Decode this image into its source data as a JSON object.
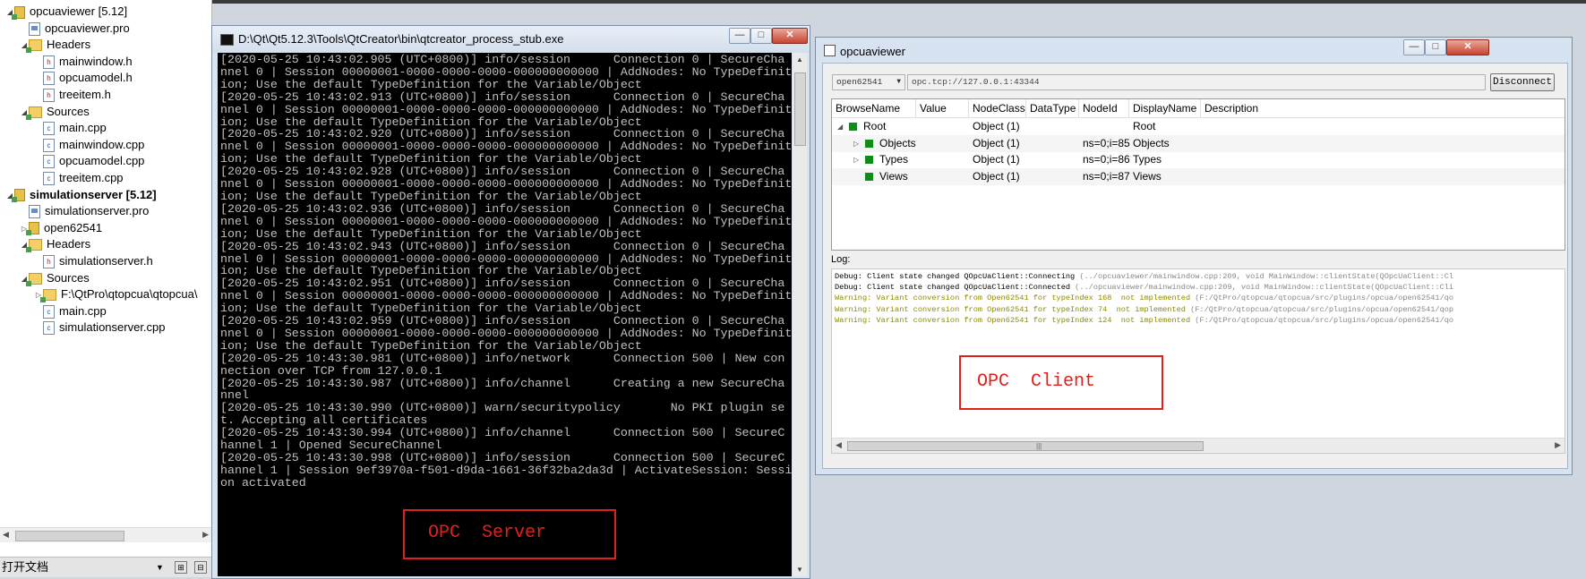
{
  "project_tree": {
    "rows": [
      {
        "label": "opcuaviewer [5.12]",
        "icon": "project-icon",
        "arrow": "◢",
        "bold": false
      },
      {
        "label": "opcuaviewer.pro",
        "icon": "pro-file-icon",
        "arrow": "",
        "bold": false
      },
      {
        "label": "Headers",
        "icon": "folder-icon",
        "arrow": "◢",
        "bold": false
      },
      {
        "label": "mainwindow.h",
        "icon": "header-file-icon",
        "arrow": "",
        "bold": false
      },
      {
        "label": "opcuamodel.h",
        "icon": "header-file-icon",
        "arrow": "",
        "bold": false
      },
      {
        "label": "treeitem.h",
        "icon": "header-file-icon",
        "arrow": "",
        "bold": false
      },
      {
        "label": "Sources",
        "icon": "folder-icon",
        "arrow": "◢",
        "bold": false
      },
      {
        "label": "main.cpp",
        "icon": "cpp-file-icon",
        "arrow": "",
        "bold": false
      },
      {
        "label": "mainwindow.cpp",
        "icon": "cpp-file-icon",
        "arrow": "",
        "bold": false
      },
      {
        "label": "opcuamodel.cpp",
        "icon": "cpp-file-icon",
        "arrow": "",
        "bold": false
      },
      {
        "label": "treeitem.cpp",
        "icon": "cpp-file-icon",
        "arrow": "",
        "bold": false
      },
      {
        "label": "simulationserver [5.12]",
        "icon": "project-icon",
        "arrow": "◢",
        "bold": true
      },
      {
        "label": "simulationserver.pro",
        "icon": "pro-file-icon",
        "arrow": "",
        "bold": false
      },
      {
        "label": "open62541",
        "icon": "project-icon",
        "arrow": "▷",
        "bold": false
      },
      {
        "label": "Headers",
        "icon": "folder-icon",
        "arrow": "◢",
        "bold": false
      },
      {
        "label": "simulationserver.h",
        "icon": "header-file-icon",
        "arrow": "",
        "bold": false
      },
      {
        "label": "Sources",
        "icon": "folder-icon",
        "arrow": "◢",
        "bold": false
      },
      {
        "label": "F:\\QtPro\\qtopcua\\qtopcua\\",
        "icon": "folder-icon",
        "arrow": "▷",
        "bold": false
      },
      {
        "label": "main.cpp",
        "icon": "cpp-file-icon",
        "arrow": "",
        "bold": false
      },
      {
        "label": "simulationserver.cpp",
        "icon": "cpp-file-icon",
        "arrow": "",
        "bold": false
      }
    ],
    "open_documents_label": "打开文档"
  },
  "console": {
    "title": "D:\\Qt\\Qt5.12.3\\Tools\\QtCreator\\bin\\qtcreator_process_stub.exe",
    "lines": [
      "[2020-05-25 10:43:02.905 (UTC+0800)] info/session      Connection 0 | SecureCha",
      "nnel 0 | Session 00000001-0000-0000-0000-000000000000 | AddNodes: No TypeDefinit",
      "ion; Use the default TypeDefinition for the Variable/Object",
      "[2020-05-25 10:43:02.913 (UTC+0800)] info/session      Connection 0 | SecureCha",
      "nnel 0 | Session 00000001-0000-0000-0000-000000000000 | AddNodes: No TypeDefinit",
      "ion; Use the default TypeDefinition for the Variable/Object",
      "[2020-05-25 10:43:02.920 (UTC+0800)] info/session      Connection 0 | SecureCha",
      "nnel 0 | Session 00000001-0000-0000-0000-000000000000 | AddNodes: No TypeDefinit",
      "ion; Use the default TypeDefinition for the Variable/Object",
      "[2020-05-25 10:43:02.928 (UTC+0800)] info/session      Connection 0 | SecureCha",
      "nnel 0 | Session 00000001-0000-0000-0000-000000000000 | AddNodes: No TypeDefinit",
      "ion; Use the default TypeDefinition for the Variable/Object",
      "[2020-05-25 10:43:02.936 (UTC+0800)] info/session      Connection 0 | SecureCha",
      "nnel 0 | Session 00000001-0000-0000-0000-000000000000 | AddNodes: No TypeDefinit",
      "ion; Use the default TypeDefinition for the Variable/Object",
      "[2020-05-25 10:43:02.943 (UTC+0800)] info/session      Connection 0 | SecureCha",
      "nnel 0 | Session 00000001-0000-0000-0000-000000000000 | AddNodes: No TypeDefinit",
      "ion; Use the default TypeDefinition for the Variable/Object",
      "[2020-05-25 10:43:02.951 (UTC+0800)] info/session      Connection 0 | SecureCha",
      "nnel 0 | Session 00000001-0000-0000-0000-000000000000 | AddNodes: No TypeDefinit",
      "ion; Use the default TypeDefinition for the Variable/Object",
      "[2020-05-25 10:43:02.959 (UTC+0800)] info/session      Connection 0 | SecureCha",
      "nnel 0 | Session 00000001-0000-0000-0000-000000000000 | AddNodes: No TypeDefinit",
      "ion; Use the default TypeDefinition for the Variable/Object",
      "[2020-05-25 10:43:30.981 (UTC+0800)] info/network      Connection 500 | New con",
      "nection over TCP from 127.0.0.1",
      "[2020-05-25 10:43:30.987 (UTC+0800)] info/channel      Creating a new SecureCha",
      "nnel",
      "[2020-05-25 10:43:30.990 (UTC+0800)] warn/securitypolicy       No PKI plugin se",
      "t. Accepting all certificates",
      "[2020-05-25 10:43:30.994 (UTC+0800)] info/channel      Connection 500 | SecureC",
      "hannel 1 | Opened SecureChannel",
      "[2020-05-25 10:43:30.998 (UTC+0800)] info/session      Connection 500 | SecureC",
      "hannel 1 | Session 9ef3970a-f501-d9da-1661-36f32ba2da3d | ActivateSession: Sessi",
      "on activated"
    ]
  },
  "annotations": {
    "server": "OPC  Server",
    "client": "OPC  Client",
    "color": "#e0201c"
  },
  "client": {
    "title": "opcuaviewer",
    "backend": "open62541",
    "url": "opc.tcp://127.0.0.1:43344",
    "disconnect_label": "Disconnect",
    "columns": [
      "BrowseName",
      "Value",
      "NodeClass",
      "DataType",
      "NodeId",
      "DisplayName",
      "Description"
    ],
    "rows": [
      {
        "browse_name": "Root",
        "value": "",
        "node_class": "Object (1)",
        "data_type": "",
        "node_id": "",
        "display_name": "Root",
        "description": "",
        "expander": "◢"
      },
      {
        "browse_name": "Objects",
        "value": "",
        "node_class": "Object (1)",
        "data_type": "",
        "node_id": "ns=0;i=85",
        "display_name": "Objects",
        "description": "",
        "expander": "▷"
      },
      {
        "browse_name": "Types",
        "value": "",
        "node_class": "Object (1)",
        "data_type": "",
        "node_id": "ns=0;i=86",
        "display_name": "Types",
        "description": "",
        "expander": "▷"
      },
      {
        "browse_name": "Views",
        "value": "",
        "node_class": "Object (1)",
        "data_type": "",
        "node_id": "ns=0;i=87",
        "display_name": "Views",
        "description": "",
        "expander": ""
      }
    ],
    "log_label": "Log:",
    "log_lines": [
      {
        "level": "debug",
        "text": "Debug: Client state changed QOpcUaClient::Connecting",
        "src": " (../opcuaviewer/mainwindow.cpp:209, void MainWindow::clientState(QOpcUaClient::Cl"
      },
      {
        "level": "debug",
        "text": "Debug: Client state changed QOpcUaClient::Connected",
        "src": " (../opcuaviewer/mainwindow.cpp:209, void MainWindow::clientState(QOpcUaClient::Cli"
      },
      {
        "level": "warn",
        "text": "Warning: Variant conversion from Open62541 for typeIndex 168  not implemented",
        "src": " (F:/QtPro/qtopcua/qtopcua/src/plugins/opcua/open62541/qo"
      },
      {
        "level": "warn",
        "text": "Warning: Variant conversion from Open62541 for typeIndex 74  not implemented",
        "src": " (F:/QtPro/qtopcua/qtopcua/src/plugins/opcua/open62541/qop"
      },
      {
        "level": "warn",
        "text": "Warning: Variant conversion from Open62541 for typeIndex 124  not implemented",
        "src": " (F:/QtPro/qtopcua/qtopcua/src/plugins/opcua/open62541/qo"
      }
    ]
  }
}
